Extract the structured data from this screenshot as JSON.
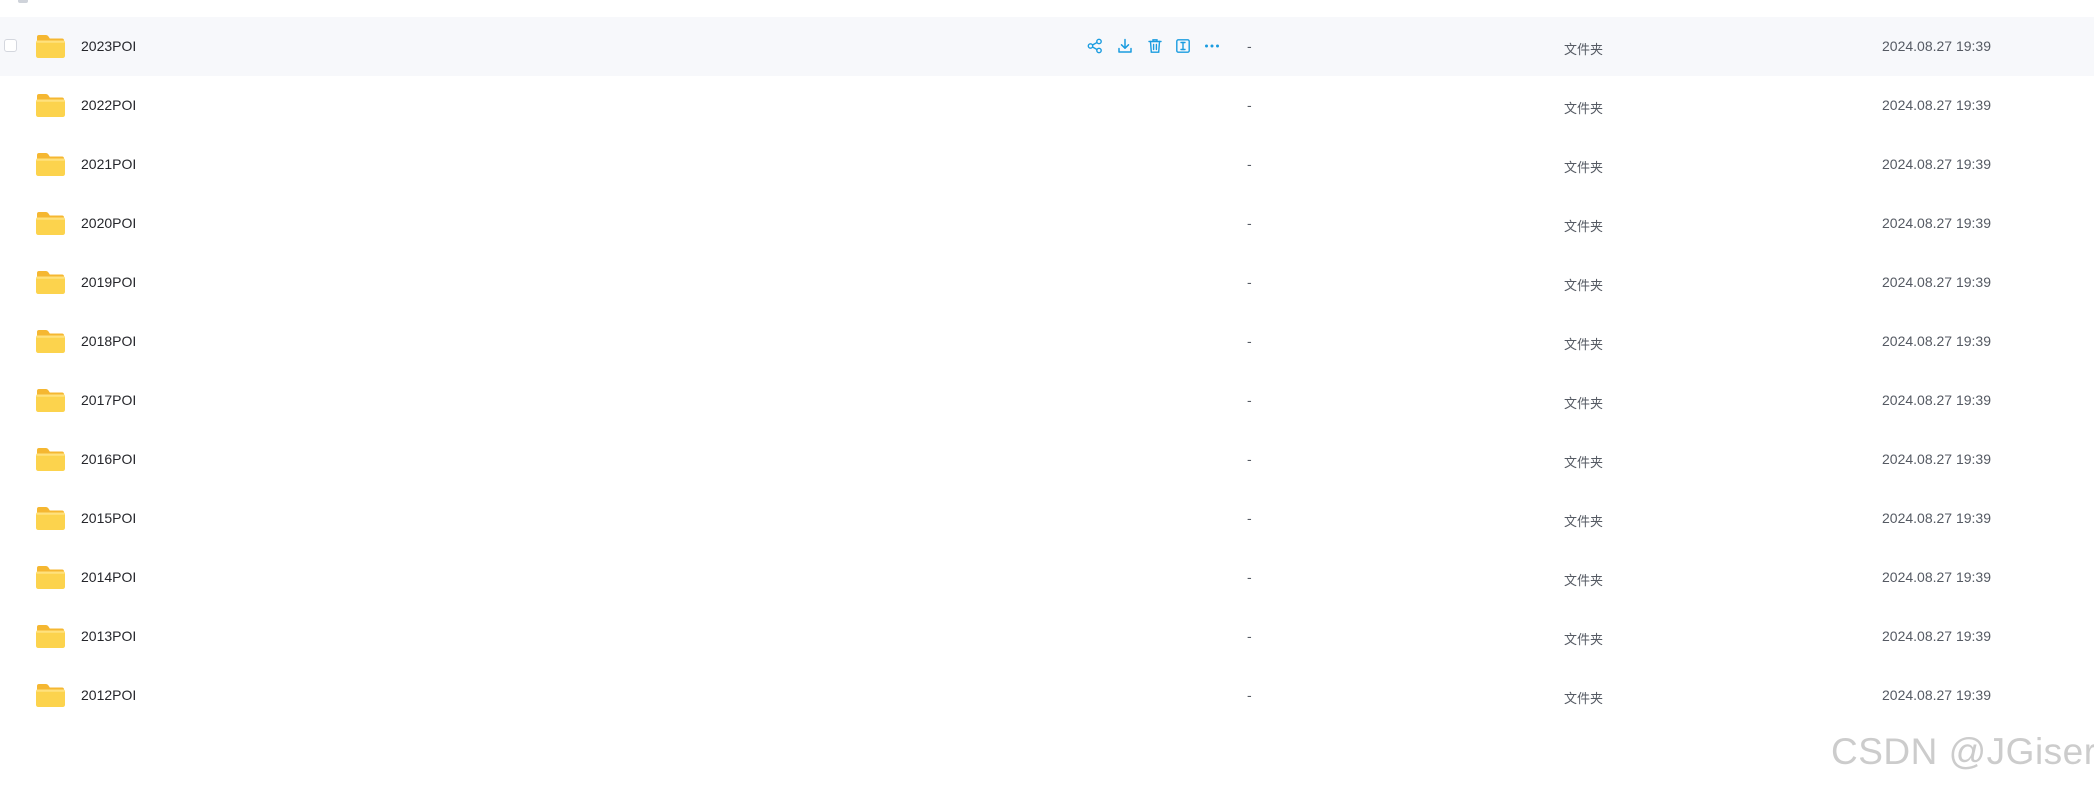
{
  "colors": {
    "accent": "#1a9ce0",
    "row_hover_bg": "#f7f8fb",
    "folder_yellow": "#fcd34d",
    "folder_yellow_dark": "#f5b731",
    "text_primary": "#25262b",
    "text_secondary": "#555a63"
  },
  "row_actions": [
    {
      "name": "share-icon",
      "label": "share"
    },
    {
      "name": "download-icon",
      "label": "download"
    },
    {
      "name": "delete-icon",
      "label": "delete"
    },
    {
      "name": "rename-icon",
      "label": "rename"
    },
    {
      "name": "more-icon",
      "label": "more"
    }
  ],
  "files": [
    {
      "name": "2023POI",
      "size": "-",
      "type": "文件夹",
      "modified": "2024.08.27 19:39",
      "hovered": true
    },
    {
      "name": "2022POI",
      "size": "-",
      "type": "文件夹",
      "modified": "2024.08.27 19:39"
    },
    {
      "name": "2021POI",
      "size": "-",
      "type": "文件夹",
      "modified": "2024.08.27 19:39"
    },
    {
      "name": "2020POI",
      "size": "-",
      "type": "文件夹",
      "modified": "2024.08.27 19:39"
    },
    {
      "name": "2019POI",
      "size": "-",
      "type": "文件夹",
      "modified": "2024.08.27 19:39"
    },
    {
      "name": "2018POI",
      "size": "-",
      "type": "文件夹",
      "modified": "2024.08.27 19:39"
    },
    {
      "name": "2017POI",
      "size": "-",
      "type": "文件夹",
      "modified": "2024.08.27 19:39"
    },
    {
      "name": "2016POI",
      "size": "-",
      "type": "文件夹",
      "modified": "2024.08.27 19:39"
    },
    {
      "name": "2015POI",
      "size": "-",
      "type": "文件夹",
      "modified": "2024.08.27 19:39"
    },
    {
      "name": "2014POI",
      "size": "-",
      "type": "文件夹",
      "modified": "2024.08.27 19:39"
    },
    {
      "name": "2013POI",
      "size": "-",
      "type": "文件夹",
      "modified": "2024.08.27 19:39"
    },
    {
      "name": "2012POI",
      "size": "-",
      "type": "文件夹",
      "modified": "2024.08.27 19:39"
    }
  ],
  "watermark": "CSDN @JGiser"
}
